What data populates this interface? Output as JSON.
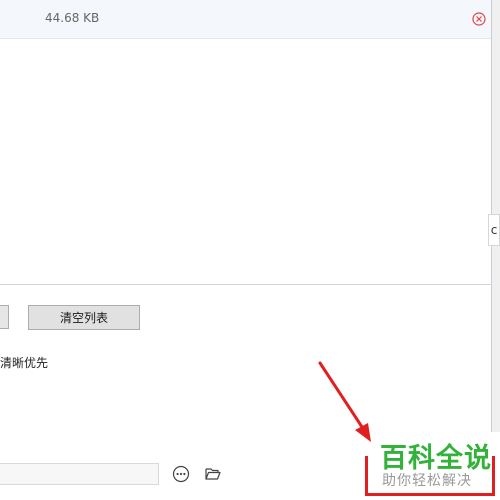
{
  "file_item": {
    "size": "44.68 KB",
    "remove_icon": "close-circle-icon"
  },
  "edge_indicator": {
    "text": "c"
  },
  "buttons": {
    "clear_list": "清空列表"
  },
  "options": {
    "quality_label": "清晰优先"
  },
  "save_path": {
    "value": "",
    "more_icon": "ellipsis-circle-icon",
    "folder_icon": "folder-open-icon"
  },
  "watermark": {
    "title": "百科全说",
    "subtitle": "助你轻松解决"
  },
  "colors": {
    "accent_red": "#e02020",
    "watermark_green": "#33b23a",
    "watermark_gray": "#999999"
  }
}
